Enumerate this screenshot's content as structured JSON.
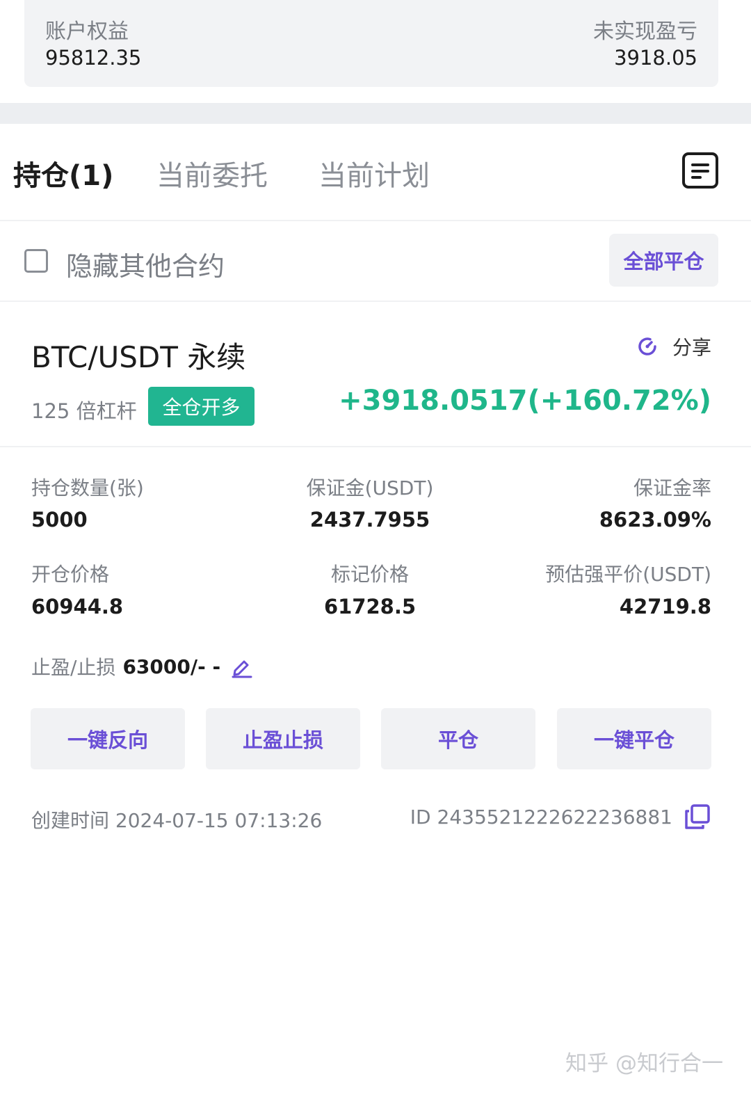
{
  "account": {
    "equity_label": "账户权益",
    "equity_value": "95812.35",
    "unrealized_label": "未实现盈亏",
    "unrealized_value": "3918.05"
  },
  "tabs": [
    {
      "label": "持仓(1)",
      "active": true
    },
    {
      "label": "当前委托",
      "active": false
    },
    {
      "label": "当前计划",
      "active": false
    }
  ],
  "filter": {
    "hide_other_label": "隐藏其他合约",
    "checked": false,
    "close_all_label": "全部平仓"
  },
  "position": {
    "symbol": "BTC/USDT 永续",
    "share_label": "分享",
    "leverage": "125 倍杠杆",
    "mode_tag": "全仓开多",
    "pnl": "+3918.0517(+160.72%)",
    "stats": {
      "qty_label": "持仓数量(张)",
      "qty_value": "5000",
      "margin_label": "保证金(USDT)",
      "margin_value": "2437.7955",
      "margin_rate_label": "保证金率",
      "margin_rate_value": "8623.09%",
      "entry_label": "开仓价格",
      "entry_value": "60944.8",
      "mark_label": "标记价格",
      "mark_value": "61728.5",
      "liq_label": "预估强平价(USDT)",
      "liq_value": "42719.8"
    },
    "tpsl_label": "止盈/止损",
    "tpsl_value": "63000/- -",
    "actions": {
      "reverse": "一键反向",
      "tpsl": "止盈止损",
      "close": "平仓",
      "quick_close": "一键平仓"
    },
    "created": "创建时间 2024-07-15 07:13:26",
    "id": "ID 2435521222622236881"
  },
  "watermark": "知乎 @知行合一",
  "colors": {
    "accent": "#6a4fd6",
    "profit": "#1fb68a",
    "tag_bg": "#21b591"
  },
  "icons": [
    "list-icon",
    "refresh-share-icon",
    "edit-pen-icon",
    "copy-icon"
  ]
}
